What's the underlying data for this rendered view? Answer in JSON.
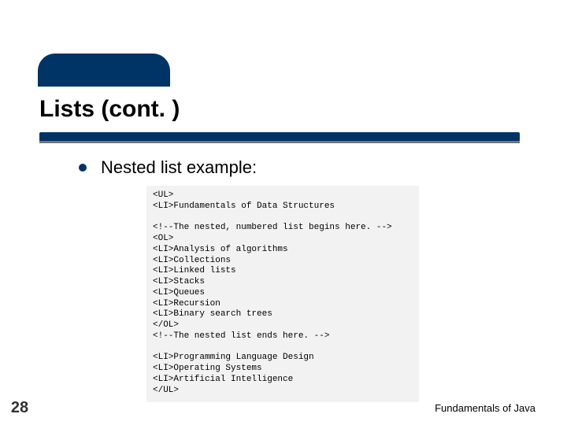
{
  "slide": {
    "title": "Lists (cont. )",
    "bullet_text": "Nested list example:",
    "page_number": "28",
    "footer": "Fundamentals of Java"
  },
  "code": {
    "lines": [
      "<UL>",
      "<LI>Fundamentals of Data Structures",
      "",
      "<!--The nested, numbered list begins here. -->",
      "<OL>",
      "<LI>Analysis of algorithms",
      "<LI>Collections",
      "<LI>Linked lists",
      "<LI>Stacks",
      "<LI>Queues",
      "<LI>Recursion",
      "<LI>Binary search trees",
      "</OL>",
      "<!--The nested list ends here. -->",
      "",
      "<LI>Programming Language Design",
      "<LI>Operating Systems",
      "<LI>Artificial Intelligence",
      "</UL>"
    ]
  }
}
